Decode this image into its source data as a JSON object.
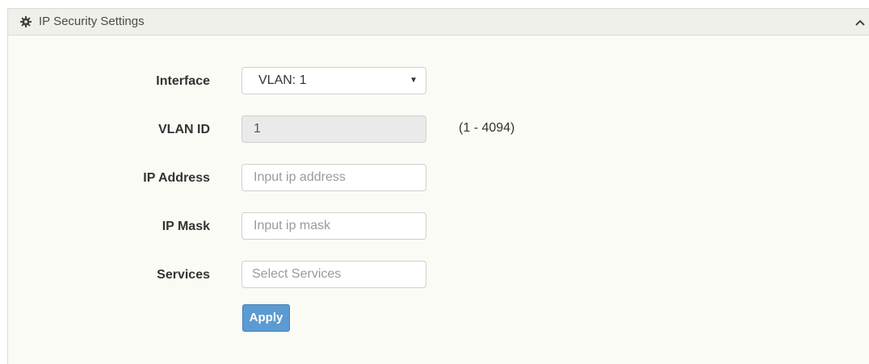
{
  "panel": {
    "title": "IP Security Settings",
    "header_icon": "gear-icon",
    "collapse_icon": "chevron-up-icon"
  },
  "form": {
    "interface": {
      "label": "Interface",
      "selected": "VLAN: 1"
    },
    "vlan_id": {
      "label": "VLAN ID",
      "value": "1",
      "range_hint": "(1 - 4094)"
    },
    "ip_address": {
      "label": "IP Address",
      "placeholder": "Input ip address"
    },
    "ip_mask": {
      "label": "IP Mask",
      "placeholder": "Input ip mask"
    },
    "services": {
      "label": "Services",
      "placeholder": "Select Services"
    },
    "apply_label": "Apply"
  },
  "colors": {
    "apply_button": "#5b9bd1",
    "panel_background": "#fbfbf6",
    "header_background": "#f0f0ea"
  }
}
